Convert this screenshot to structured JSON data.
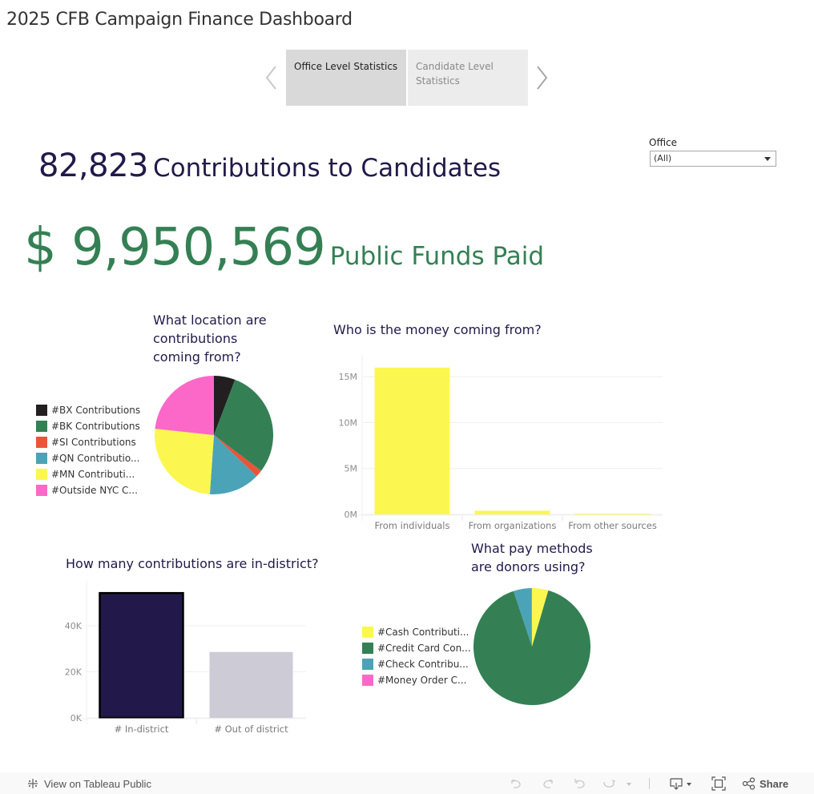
{
  "app": {
    "title": "2025 CFB Campaign Finance Dashboard"
  },
  "tabs": [
    {
      "label": "Office Level Statistics",
      "selected": true
    },
    {
      "label": "Candidate Level Statistics",
      "selected": false
    }
  ],
  "filter": {
    "label": "Office",
    "value": "(All)"
  },
  "kpis": {
    "contributions": {
      "value": "82,823",
      "label": "Contributions to Candidates",
      "color": "#22194a"
    },
    "public_funds": {
      "value": "$ 9,950,569",
      "label": "Public Funds Paid",
      "color": "#348054"
    }
  },
  "chart_data": [
    {
      "id": "location",
      "type": "pie",
      "title": "What location are contributions coming from?",
      "title_lines": [
        "What location are",
        "contributions",
        "coming from?"
      ],
      "legend_position": "left",
      "categories": [
        "#BX Contributions",
        "#BK Contributions",
        "#SI Contributions",
        "#QN Contributio...",
        "#MN Contributi...",
        "#Outside NYC C..."
      ],
      "values": [
        5.8,
        29.5,
        1.9,
        13.9,
        25.6,
        23.3
      ],
      "unit": "percent (estimated share)",
      "colors": [
        "#231f20",
        "#348054",
        "#e8553a",
        "#4ba3b7",
        "#fbf750",
        "#fc68c8"
      ]
    },
    {
      "id": "source",
      "type": "bar",
      "title": "Who is the money coming from?",
      "categories": [
        "From individuals",
        "From organizations",
        "From other sources"
      ],
      "values": [
        16000000,
        400000,
        80000
      ],
      "ylim": [
        0,
        16500000
      ],
      "yticks": [
        0,
        5000000,
        10000000,
        15000000
      ],
      "ytick_labels": [
        "0M",
        "5M",
        "10M",
        "15M"
      ],
      "xlabel": "",
      "ylabel": "",
      "grid": true,
      "color": "#fbf750"
    },
    {
      "id": "district",
      "type": "bar",
      "title": "How many contributions are in-district?",
      "categories": [
        "# In-district",
        "# Out of district"
      ],
      "values": [
        54200,
        28600
      ],
      "ylim": [
        0,
        56000
      ],
      "yticks": [
        0,
        20000,
        40000
      ],
      "ytick_labels": [
        "0K",
        "20K",
        "40K"
      ],
      "xlabel": "",
      "ylabel": "",
      "grid": true,
      "colors": [
        "#22194a",
        "#cdcbd6"
      ],
      "highlighted": "# In-district"
    },
    {
      "id": "paymethod",
      "type": "pie",
      "title": "What pay methods are donors using?",
      "title_lines": [
        "What pay methods",
        "are donors using?"
      ],
      "legend_position": "left",
      "categories": [
        "#Cash Contributi...",
        "#Credit Card Con...",
        "#Check Contribu...",
        "#Money Order C..."
      ],
      "values": [
        4.5,
        90.4,
        5.0,
        0.1
      ],
      "unit": "percent (estimated share)",
      "colors": [
        "#fbf750",
        "#348054",
        "#4ba3b7",
        "#fc68c8"
      ]
    }
  ],
  "footer": {
    "view_label": "View on Tableau Public",
    "share_label": "Share",
    "icons": [
      "tableau-logo-icon",
      "undo-icon",
      "redo-icon",
      "revert-icon",
      "refresh-icon",
      "pause-dropdown-icon",
      "download-icon",
      "fullscreen-icon",
      "share-icon"
    ]
  }
}
